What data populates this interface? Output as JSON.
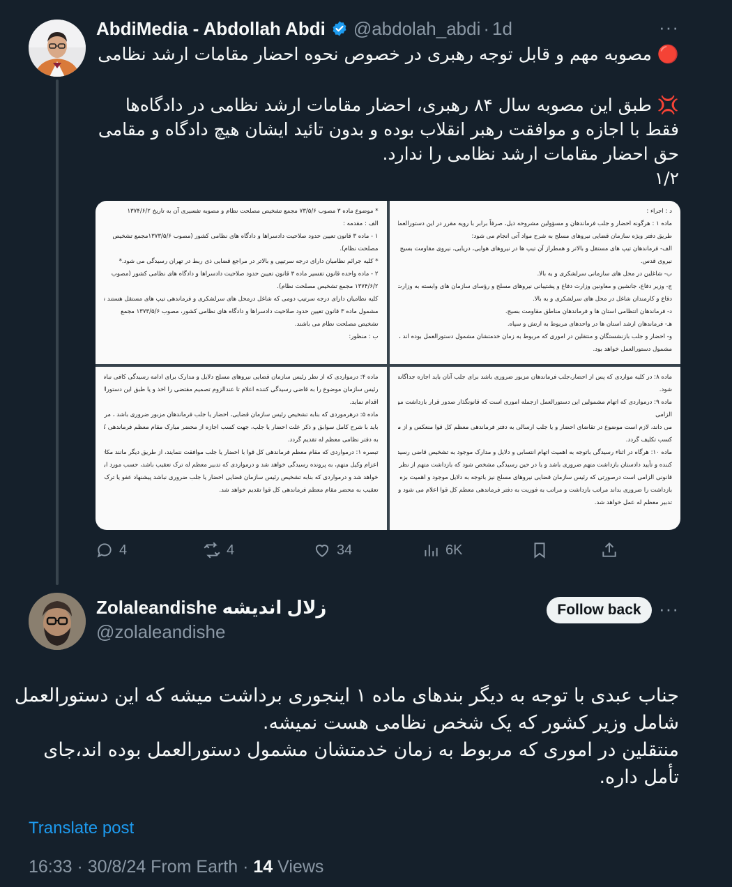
{
  "tweet1": {
    "author_name": "AbdiMedia - Abdollah Abdi",
    "handle": "@abdolah_abdi",
    "separator": "·",
    "time_ago": "1d",
    "line1": "🔴 مصوبه مهم و قابل توجه رهبری در خصوص نحوه احضار مقامات ارشد نظامی",
    "paragraph": "💢 طبق این مصوبه سال ۸۴ رهبری، احضار مقامات ارشد نظامی در دادگاه‌ها فقط با اجازه و موافقت رهبر انقلاب بوده و بدون تائید ایشان هیچ دادگاه و مقامی حق احضار مقامات ارشد نظامی را ندارد.\n۱/۲",
    "media": {
      "doc1": [
        "* موضوع ماده ۳ مصوب ۷۳/۵/۶ مجمع تشخیص مصلحت نظام و مصوبه تفسیری آن به تاریخ ۱۳۷۴/۶/۲",
        "الف : مقدمه :",
        "۱ - ماده ۳ قانون تعیین حدود صلاحیت دادسراها و دادگاه های نظامی کشور (مصوب ۱۳۷۳/۵/۶مجمع تشخیص",
        "مصلحت نظام).",
        "* کلیه جرائم نظامیان دارای درجه سرتیپی و بالاتر در مراجع قضایی ذی ربط در تهران رسیدگی می شود.*",
        "۲ - ماده واحده قانون تفسیر ماده ۳ قانون تعیین حدود صلاحیت دادسراها و دادگاه های نظامی کشور (مصوب",
        "۱۳۷۴/۶/۲ مجمع تشخیص مصلحت نظام).",
        "کلیه نظامیان دارای درجه سرتیپ دومی که شاغل درمحل های سرلشکری و فرماندهی تیپ های مستقل هستند تبق",
        "مشمول ماده ۳ قانون تعیین حدود صلاحیت دادسراها و دادگاه های نظامی کشور، مصوب ۱۳۷۳/۵/۶ مجمع",
        "تشخیص مصلحت نظام می باشند.",
        "ب : منظور:"
      ],
      "doc2": [
        "د : اجراء :",
        "ماده ۱ : هرگونه احضار و جلب فرماندهان و مسؤولین مشروحه ذیل، صرفاً برابر با رویه مقرر در این دستورالعمل، از",
        "طریق دفتر ویژه سازمان قضایی نیروهای مسلح به شرح مواد آتی انجام می شود:",
        "الف- فرماندهان تیپ های مستقل و بالاتر و همطراز آن تیپ ها در نیروهای هوایی، دریایی، نیروی مقاومت بسیج و",
        "نیروی قدس.",
        "ب- شاغلین در محل های سازمانی سرلشکری و به بالا.",
        "ج- وزیر دفاع، جانشین و معاونین وزارت دفاع و پشتیبانی نیروهای مسلح و رؤسای سازمان های وابسته به وزارت",
        "دفاع و کارمندان شاغل در محل های سرلشکری و به بالا.",
        "د- فرماندهان انتظامی استان ها و فرماندهان مناطق مقاومت بسیج.",
        "هـ- فرماندهان ارشد استان ها در واحدهای مربوط به ارتش و سپاه.",
        "و- احضار و جلب بازنشستگان و منتقلین در اموری که مربوط به زمان خدمتشان مشمول دستورالعمل بوده اند ، کماکان",
        "مشمول دستورالعمل خواهد بود."
      ],
      "doc3": [
        "ماده ۴: درمواردی که از نظر رئیس سازمان قضایی نیروهای مسلح دلایل و مدارک برای ادامه رسیدگی کافی نباشد",
        "رئیس سازمان موضوع را به قاضی رسیدگی کننده اعلام تا عندالزوم تصمیم مقتضی را اخذ و یا طبق این دستورالعمل",
        "اقدام نماید.",
        "ماده ۵: درهرموردی که بنابه تشخیص رئیس سازمان قضایی، احضار یا جلب فرماندهان مزبور ضروری باشد ، مراتب",
        "باید با شرح کامل سوابق و ذکر علت احضار یا جلب، جهت کسب اجازه از محضر مبارک مقام معظم فرماندهی کل قوا",
        "به دفتر نظامی معظم له تقدیم گردد.",
        "تبصره ۱: درمواردی که مقام معظم فرماندهی کل قوا با احضار یا جلب موافقت ننمایند، از طریق دیگر مانند مکاتبه یا",
        "اعزام وکیل متهم، به پرونده رسیدگی خواهد شد و درمواردی که تدبیر معظم له ترک تعقیب باشد، حسب مورد ابلاغ",
        "خواهد شد و درمواردی که بنابه تشخیص رئیس سازمان قضایی احضار یا جلب ضروری نباشد پیشنهاد عفو یا ترک",
        "تعقیب به محضر مقام معظم فرماندهی کل قوا تقدیم خواهد شد."
      ],
      "doc4": [
        "ماده ۸: در کلیه مواردی که پس از احضار،جلب فرماندهان مزبور ضروری باشد برای جلب آنان باید اجازه جداگانه اخذ",
        "شود.",
        "ماده ۹: درمواردی که اتهام مشمولین این دستورالعمل ازجمله اموری است که قانونگذار صدور قرار بازداشت موقت را",
        "الزامی",
        "می داند، لازم است موضوع در تقاضای احضار و یا جلب ارسالی به دفتر فرماندهی معظم کل قوا منعکس و از معظم له",
        "کسب تکلیف گردد.",
        "ماده ۱۰: هرگاه در اثناء رسیدگی باتوجه به اهمیت اتهام انتسابی و دلایل و مدارک موجود به تشخیص قاضی رسیدگی",
        "کننده و تأیید دادستان بازداشت متهم ضروری باشد و یا در حین رسیدگی مشخص شود که بازداشت متهم از نظر",
        "قانونی الزامی است درصورتی که رئیس سازمان قضایی نیروهای مسلح نیز باتوجه به دلایل موجود و اهمیت بزه ،",
        "بازداشت را ضروری بداند مراتب بازداشت و مراتب به فوریت به دفتر فرماندهی معظم کل قوا اعلام می شود و طبق",
        "تدبیر معظم له عمل خواهد شد."
      ]
    },
    "actions": {
      "replies": "4",
      "reposts": "4",
      "likes": "34",
      "views": "6K"
    }
  },
  "tweet2": {
    "author_name": "Zolaleandishe زلال اندیشه",
    "handle": "@zolaleandishe",
    "follow_label": "Follow back",
    "paragraph": "جناب عبدی با توجه به دیگر بندهای ماده ۱ اینجوری برداشت میشه که این دستورالعمل شامل وزیر کشور که یک شخص نظامی هست نمیشه.\nمنتقلین در اموری که مربوط به زمان خدمتشان مشمول دستورالعمل بوده اند،جای تأمل داره.",
    "translate_label": "Translate post",
    "timestamp": "16:33 · 30/8/24 From Earth ·",
    "views_count": "14",
    "views_label": "Views"
  },
  "icons": [
    "reply-icon",
    "repost-icon",
    "like-icon",
    "views-icon",
    "bookmark-icon",
    "share-icon",
    "verified-icon",
    "more-icon"
  ],
  "colors": {
    "background": "#15202b",
    "accent": "#1d9bf0",
    "muted": "#8b98a5"
  }
}
